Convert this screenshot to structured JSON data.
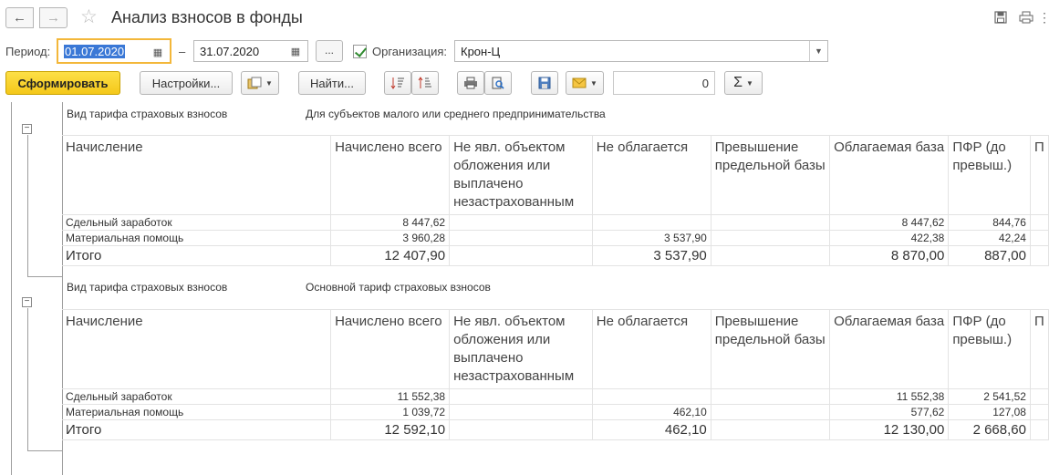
{
  "window": {
    "title": "Анализ взносов в фонды",
    "back_icon": "←",
    "forward_icon": "→"
  },
  "filters": {
    "period_label": "Период:",
    "date_from": "01.07.2020",
    "dash": "–",
    "date_to": "31.07.2020",
    "dots_label": "...",
    "org_checked": true,
    "org_label": "Организация:",
    "org_value": "Крон-Ц"
  },
  "toolbar": {
    "generate_label": "Сформировать",
    "settings_label": "Настройки...",
    "find_label": "Найти...",
    "number_value": "0",
    "sum_symbol": "Σ"
  },
  "report": {
    "columns": [
      "Начисление",
      "Начислено всего",
      "Не явл. объектом обложения или выплачено незастрахованным",
      "Не облагается",
      "Превышение предельной базы",
      "Облагаемая база",
      "ПФР (до превыш.)",
      "П"
    ],
    "groups": [
      {
        "key_label": "Вид тарифа страховых взносов",
        "key_value": "Для субъектов малого или среднего предпринимательства",
        "rows": [
          [
            "Сдельный заработок",
            "8 447,62",
            "",
            "",
            "",
            "8 447,62",
            "844,76",
            ""
          ],
          [
            "Материальная помощь",
            "3 960,28",
            "",
            "3 537,90",
            "",
            "422,38",
            "42,24",
            ""
          ]
        ],
        "total": [
          "Итого",
          "12 407,90",
          "",
          "3 537,90",
          "",
          "8 870,00",
          "887,00",
          ""
        ]
      },
      {
        "key_label": "Вид тарифа страховых взносов",
        "key_value": "Основной тариф страховых взносов",
        "rows": [
          [
            "Сдельный заработок",
            "11 552,38",
            "",
            "",
            "",
            "11 552,38",
            "2 541,52",
            ""
          ],
          [
            "Материальная помощь",
            "1 039,72",
            "",
            "462,10",
            "",
            "577,62",
            "127,08",
            ""
          ]
        ],
        "total": [
          "Итого",
          "12 592,10",
          "",
          "462,10",
          "",
          "12 130,00",
          "2 668,60",
          ""
        ]
      }
    ]
  },
  "colors": {
    "accent_yellow": "#f4c81a",
    "focus_border": "#f3b73a",
    "check_green": "#2f8a2f"
  }
}
